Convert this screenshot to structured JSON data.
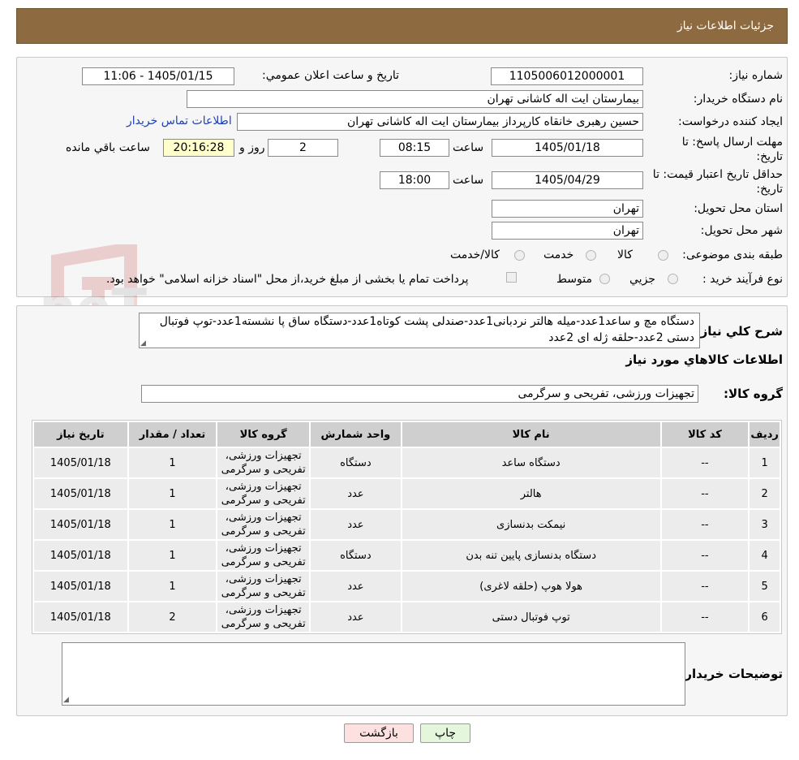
{
  "header": {
    "title": "جزئیات اطلاعات نیاز"
  },
  "info": {
    "need_number_label": "شماره نیاز:",
    "need_number": "1105006012000001",
    "announce_label": "تاریخ و ساعت اعلان عمومي:",
    "announce_value": "1405/01/15 - 11:06",
    "buyer_org_label": "نام دستگاه خریدار:",
    "buyer_org": "بیمارستان ایت اله کاشانی تهران",
    "requester_label": "ایجاد کننده درخواست:",
    "requester": "حسین رهبری خانقاه کارپرداز بیمارستان ایت اله کاشانی تهران",
    "contact_link": "اطلاعات تماس خریدار",
    "deadline_label_1": "مهلت ارسال پاسخ: تا",
    "deadline_label_2": "تاریخ:",
    "deadline_date": "1405/01/18",
    "time_label": "ساعت",
    "deadline_time": "08:15",
    "days_value": "2",
    "days_label": "روز و",
    "remaining_time": "20:16:28",
    "remaining_label": "ساعت باقي مانده",
    "validity_label_1": "حداقل تاریخ اعتبار قیمت: تا",
    "validity_label_2": "تاریخ:",
    "validity_date": "1405/04/29",
    "validity_time_label": "ساعت",
    "validity_time": "18:00",
    "province_label": "استان محل تحویل:",
    "province": "تهران",
    "city_label": "شهر محل تحویل:",
    "city": "تهران",
    "category_label": "طبقه بندی موضوعی:",
    "category_options": [
      "کالا",
      "خدمت",
      "کالا/خدمت"
    ],
    "purchase_type_label": "نوع فرآیند خرید :",
    "purchase_options": [
      "جزیي",
      "متوسط"
    ],
    "payment_note": "پرداخت تمام یا بخشی از مبلغ خرید،از محل \"اسناد خزانه اسلامی\" خواهد بود."
  },
  "watermark": {
    "text": "AriaTender.neT"
  },
  "details": {
    "description_label": "شرح کلي نیاز:",
    "description": "دستگاه مچ و ساعد1عدد-میله هالتر نردبانی1عدد-صندلی پشت کوتاه1عدد-دستگاه ساق پا نشسته1عدد-توپ فوتبال دستی 2عدد-حلقه ژله ای 2عدد",
    "goods_info_title": "اطلاعات کالاهاي مورد نیاز",
    "goods_group_label": "گروه کالا:",
    "goods_group": "تجهیزات ورزشی، تفریحی و سرگرمی",
    "columns": [
      "ردیف",
      "کد کالا",
      "نام کالا",
      "واحد شمارش",
      "گروه کالا",
      "تعداد / مقدار",
      "تاریخ نیاز"
    ],
    "rows": [
      {
        "idx": "1",
        "code": "--",
        "name": "دستگاه ساعد",
        "unit": "دستگاه",
        "group_1": "تجهیزات ورزشی،",
        "group_2": "تفریحی و سرگرمی",
        "qty": "1",
        "date": "1405/01/18"
      },
      {
        "idx": "2",
        "code": "--",
        "name": "هالتر",
        "unit": "عدد",
        "group_1": "تجهیزات ورزشی،",
        "group_2": "تفریحی و سرگرمی",
        "qty": "1",
        "date": "1405/01/18"
      },
      {
        "idx": "3",
        "code": "--",
        "name": "نیمکت بدنسازی",
        "unit": "عدد",
        "group_1": "تجهیزات ورزشی،",
        "group_2": "تفریحی و سرگرمی",
        "qty": "1",
        "date": "1405/01/18"
      },
      {
        "idx": "4",
        "code": "--",
        "name": "دستگاه بدنسازی پایین تنه بدن",
        "unit": "دستگاه",
        "group_1": "تجهیزات ورزشی،",
        "group_2": "تفریحی و سرگرمی",
        "qty": "1",
        "date": "1405/01/18"
      },
      {
        "idx": "5",
        "code": "--",
        "name": "هولا هوپ (حلقه لاغری)",
        "unit": "عدد",
        "group_1": "تجهیزات ورزشی،",
        "group_2": "تفریحی و سرگرمی",
        "qty": "1",
        "date": "1405/01/18"
      },
      {
        "idx": "6",
        "code": "--",
        "name": "توپ فوتبال دستی",
        "unit": "عدد",
        "group_1": "تجهیزات ورزشی،",
        "group_2": "تفریحی و سرگرمی",
        "qty": "2",
        "date": "1405/01/18"
      }
    ],
    "buyer_notes_label": "توضیحات خریدار:",
    "buyer_notes": ""
  },
  "buttons": {
    "print": "چاپ",
    "back": "بازگشت"
  },
  "colors": {
    "header_bg": "#8d6a3f",
    "back_button_bg": "#fde0e0",
    "print_button_bg": "#e4f7dd"
  }
}
